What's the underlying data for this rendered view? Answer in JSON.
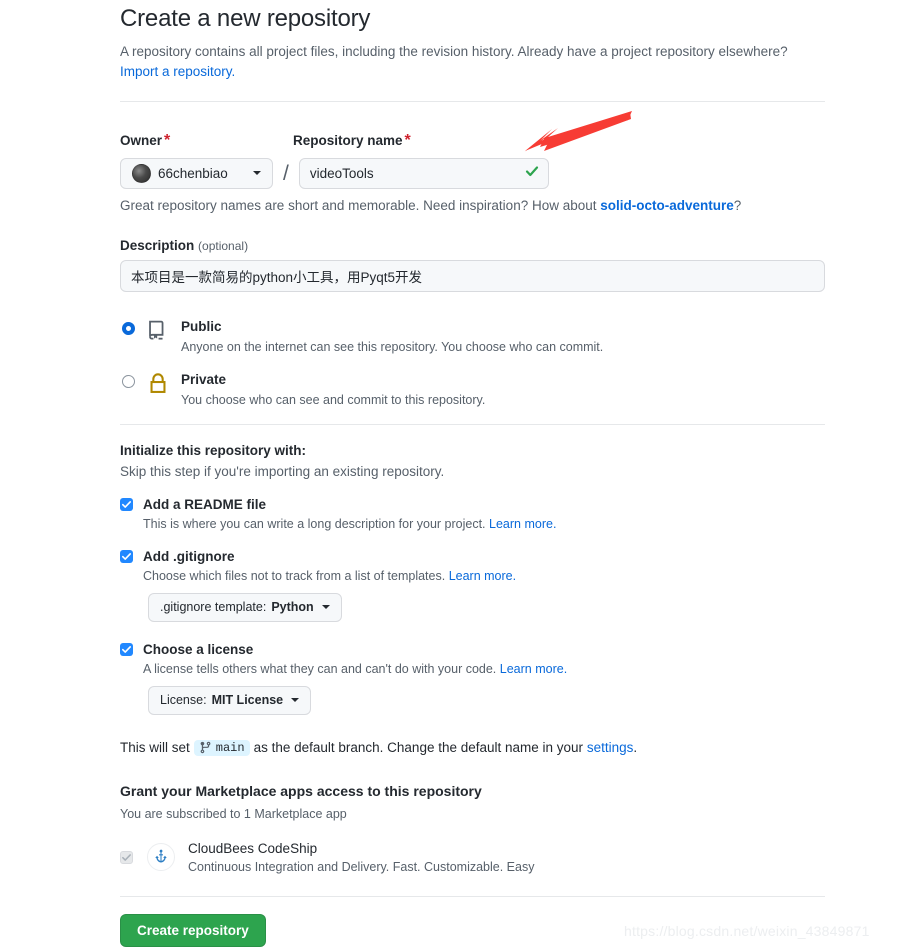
{
  "header": {
    "title": "Create a new repository",
    "subtitle": "A repository contains all project files, including the revision history. Already have a project repository elsewhere?",
    "import_link": "Import a repository."
  },
  "owner": {
    "label": "Owner",
    "required_mark": "*",
    "value": "66chenbiao",
    "avatar_icon": "user-avatar"
  },
  "repo_name": {
    "label": "Repository name",
    "required_mark": "*",
    "value": "videoTools",
    "valid_icon": "check-icon",
    "hint_prefix": "Great repository names are short and memorable. Need inspiration? How about ",
    "hint_suggestion": "solid-octo-adventure",
    "hint_suffix": "?"
  },
  "description": {
    "label": "Description",
    "optional": "(optional)",
    "value": "本项目是一款简易的python小工具，用Pyqt5开发",
    "placeholder": ""
  },
  "visibility": {
    "options": [
      {
        "id": "public",
        "title": "Public",
        "desc": "Anyone on the internet can see this repository. You choose who can commit.",
        "icon": "repo-book-icon",
        "selected": true
      },
      {
        "id": "private",
        "title": "Private",
        "desc": "You choose who can see and commit to this repository.",
        "icon": "lock-icon",
        "selected": false
      }
    ]
  },
  "initialize": {
    "title": "Initialize this repository with:",
    "subtitle": "Skip this step if you're importing an existing repository.",
    "readme": {
      "label": "Add a README file",
      "desc": "This is where you can write a long description for your project.",
      "learn_more": "Learn more.",
      "checked": true
    },
    "gitignore": {
      "label": "Add .gitignore",
      "desc": "Choose which files not to track from a list of templates.",
      "learn_more": "Learn more.",
      "checked": true,
      "select_prefix": ".gitignore template:",
      "select_value": "Python"
    },
    "license": {
      "label": "Choose a license",
      "desc": "A license tells others what they can and can't do with your code.",
      "learn_more": "Learn more.",
      "checked": true,
      "select_prefix": "License:",
      "select_value": "MIT License"
    }
  },
  "branch_note": {
    "prefix": "This will set",
    "branch": "main",
    "branch_icon": "git-branch-icon",
    "middle": "as the default branch. Change the default name in your",
    "settings_link": "settings",
    "suffix": "."
  },
  "marketplace": {
    "title": "Grant your Marketplace apps access to this repository",
    "subtitle": "You are subscribed to 1 Marketplace app",
    "app": {
      "name": "CloudBees CodeShip",
      "desc": "Continuous Integration and Delivery. Fast. Customizable. Easy",
      "logo_icon": "cloudbees-codeship-icon",
      "checked": true,
      "disabled": true
    }
  },
  "footer": {
    "create_label": "Create repository"
  },
  "annotation": {
    "arrow_color": "#f73c34",
    "arrow_icon": "red-arrow-annotation"
  },
  "watermark": {
    "text": "https://blog.csdn.net/weixin_43849871"
  },
  "colors": {
    "accent": "#0969da",
    "success": "#2da44e",
    "danger": "#cf222e",
    "lock": "#b08800"
  }
}
